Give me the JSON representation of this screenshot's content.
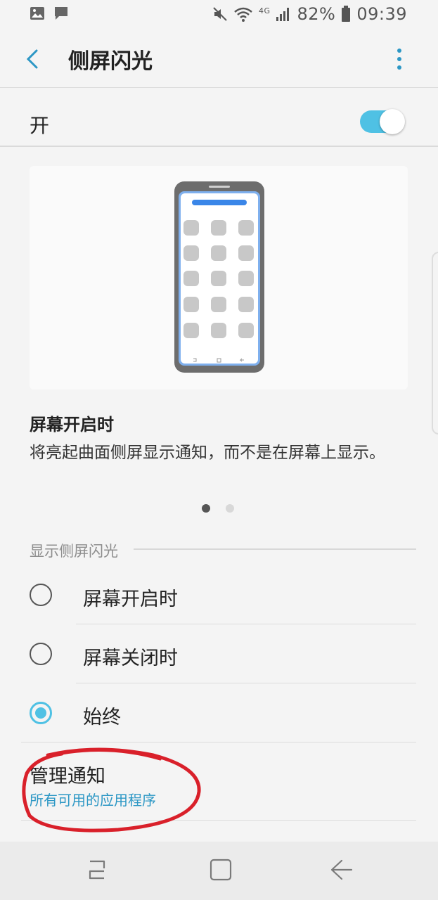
{
  "status_bar": {
    "battery": "82%",
    "time": "09:39",
    "network": "4G",
    "icons": [
      "gallery-icon",
      "message-icon",
      "mute-icon",
      "wifi-icon",
      "signal-icon",
      "battery-icon"
    ]
  },
  "header": {
    "title": "侧屏闪光"
  },
  "master_switch": {
    "label": "开",
    "on": true
  },
  "preview": {
    "title": "屏幕开启时",
    "description": "将亮起曲面侧屏显示通知，而不是在屏幕上显示。",
    "page_count": 2,
    "current_page": 1
  },
  "section": {
    "label": "显示侧屏闪光"
  },
  "options": [
    {
      "label": "屏幕开启时",
      "selected": false
    },
    {
      "label": "屏幕关闭时",
      "selected": false
    },
    {
      "label": "始终",
      "selected": true
    }
  ],
  "manage": {
    "title": "管理通知",
    "subtitle": "所有可用的应用程序"
  },
  "colors": {
    "accent": "#4fc1e4",
    "link": "#2c97c5",
    "annotation": "#d9202a"
  }
}
